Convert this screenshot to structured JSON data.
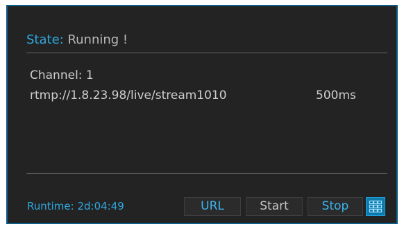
{
  "state": {
    "label": "State:",
    "value": "Running !"
  },
  "channel": "Channel: 1",
  "stream": {
    "url": "rtmp://1.8.23.98/live/stream1010",
    "latency": "500ms"
  },
  "footer": {
    "runtime": "Runtime: 2d:04:49",
    "buttons": {
      "url": "URL",
      "start": "Start",
      "stop": "Stop"
    },
    "grid_icon": "grid-icon"
  },
  "colors": {
    "panel_bg": "#232323",
    "border": "#0d5f88",
    "accent": "#2ea9e0",
    "text": "#cfcfcf"
  }
}
